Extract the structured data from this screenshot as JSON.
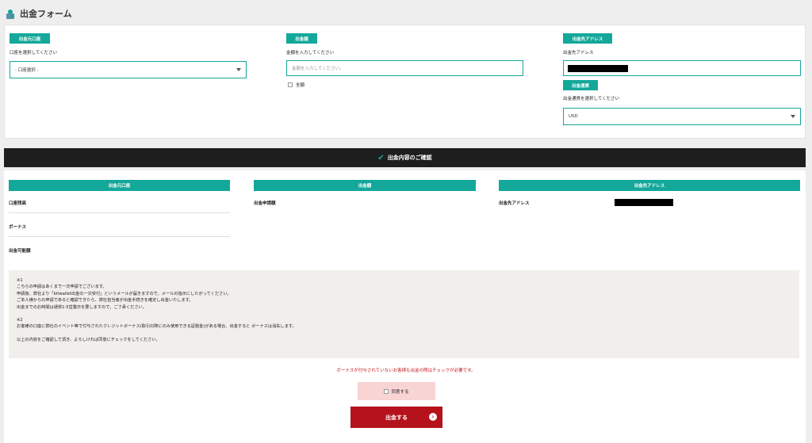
{
  "header": {
    "title": "出金フォーム",
    "icon": "wallet-icon"
  },
  "form": {
    "account": {
      "badge": "出金元口座",
      "label": "口座を選択してください",
      "select_value": "- 口座選択 -"
    },
    "amount": {
      "badge": "出金額",
      "label": "金額を入力してください",
      "placeholder": "金額を入力してください。",
      "all_label": "全額"
    },
    "address": {
      "badge": "出金先アドレス",
      "label": "出金先アドレス"
    },
    "currency": {
      "badge": "出金通貨",
      "label": "出金通貨を選択してください",
      "select_value": "USD"
    }
  },
  "confirm": {
    "bar_title": "出金内容のご確認",
    "col1": {
      "head": "出金元口座",
      "rows": [
        "口座残高",
        "ボーナス",
        "出金可能額"
      ]
    },
    "col2": {
      "head": "出金額",
      "rows": [
        "出金申請額"
      ]
    },
    "col3": {
      "head": "出金先アドレス",
      "rows": [
        "出金先アドレス"
      ]
    }
  },
  "notes": {
    "n1_title": "※1",
    "n1_l1": "こちらの申請はあくまで一次申請でございます。",
    "n1_l2": "申請後、弊社より「bitwallet出金の一次受付」というメールが届きますので、メールの指示にしたがってください。",
    "n1_l3": "ご本人様からの申請であると確認できたら、弊社担当者が出金手続きを確定し出金いたします。",
    "n1_l4": "出金までのお時間は通常1-5営業日を要しますので、ご了承ください。",
    "n2_title": "※2",
    "n2_l1": "お客様の口座に弊社のイベント等で付与されたクレジットボーナス(取引の際にのみ使用できる証拠金)がある場合、出金すると ボーナスは消失します。",
    "n2_l2": "以上の内容をご確認して頂き、よろしければ同意にチェックをしてください。"
  },
  "warning": "ボーナスが付与されていないお客様も出金の際はチェックが必要です。",
  "agree_label": "同意する",
  "submit_label": "出金する",
  "colors": {
    "accent": "#13a89a",
    "submit": "#b5121b",
    "warning": "#c3181c",
    "dark_bar": "#1e1e1e"
  }
}
